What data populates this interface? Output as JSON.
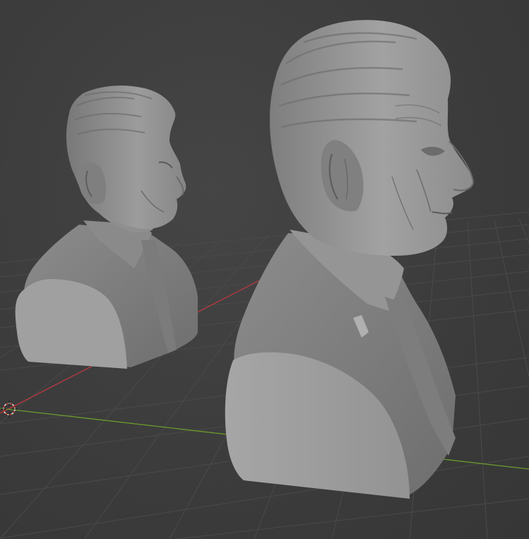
{
  "viewport": {
    "background": "#3d3d3d",
    "grid_color": "#4a4a4a",
    "x_axis_color": "#b8393f",
    "y_axis_color": "#6b9a2d",
    "cursor_color": "#e0e0e0",
    "cursor_accent": "#c0392b"
  },
  "objects": [
    {
      "name": "bust-small",
      "material_color": "#9a9a9a"
    },
    {
      "name": "bust-large",
      "material_color": "#a0a0a0"
    }
  ],
  "icons": [
    "3d-cursor-icon"
  ]
}
